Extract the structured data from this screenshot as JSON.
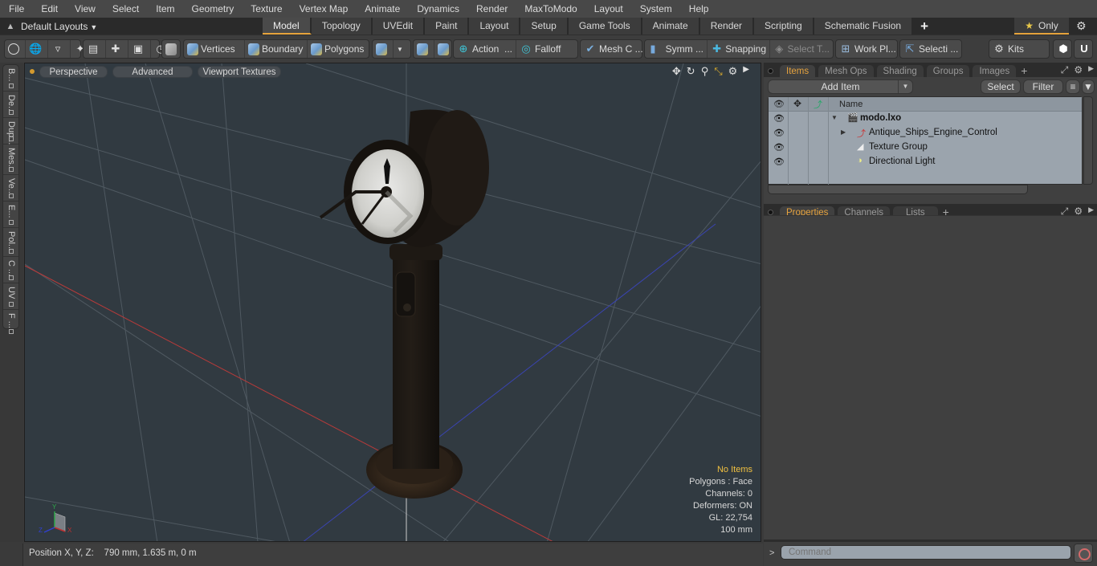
{
  "menubar": {
    "items": [
      "File",
      "Edit",
      "View",
      "Select",
      "Item",
      "Geometry",
      "Texture",
      "Vertex Map",
      "Animate",
      "Dynamics",
      "Render",
      "MaxToModo",
      "Layout",
      "System",
      "Help"
    ]
  },
  "layout_bar": {
    "layout_select": "Default Layouts",
    "tabs": [
      "Model",
      "Topology",
      "UVEdit",
      "Paint",
      "Layout",
      "Setup",
      "Game Tools",
      "Animate",
      "Render",
      "Scripting",
      "Schematic Fusion"
    ],
    "active_tab": "Model",
    "add_tab": "+",
    "only_label": "Only"
  },
  "toolbar": {
    "vertices": "Vertices",
    "boundary": "Boundary",
    "polygons": "Polygons",
    "action": "Action",
    "ellipsis": "...",
    "falloff": "Falloff",
    "mesh_c": "Mesh C ...",
    "symm": "Symm ...",
    "snapping": "Snapping",
    "select_t": "Select T...",
    "work_pl": "Work Pl...",
    "selecti": "Selecti ...",
    "kits": "Kits"
  },
  "left_tabs": [
    "B...",
    "De...",
    "Dup...",
    "Mes...",
    "Ve...",
    "E...",
    "Pol...",
    "C ...",
    "UV",
    "F ..."
  ],
  "viewport": {
    "view_mode": "Perspective",
    "shading": "Advanced",
    "textures": "Viewport Textures",
    "info": {
      "items": "No Items",
      "polygons": "Polygons : Face",
      "channels": "Channels: 0",
      "deformers": "Deformers: ON",
      "gl": "GL: 22,754",
      "scale": "100 mm"
    },
    "axis_labels": {
      "y": "Y",
      "x": "X",
      "z": "Z"
    }
  },
  "statusbar": {
    "position_label": "Position X, Y, Z:",
    "position_value": "790 mm, 1.635 m, 0 m"
  },
  "items_panel": {
    "tabs": [
      "Items",
      "Mesh Ops",
      "Shading",
      "Groups",
      "Images"
    ],
    "active_tab": "Items",
    "add_item": "Add Item",
    "select": "Select",
    "filter": "Filter",
    "column_name": "Name",
    "tree": [
      {
        "name": "modo.lxo",
        "type": "scene",
        "level": 0,
        "expanded": true
      },
      {
        "name": "Antique_Ships_Engine_Control",
        "type": "mesh",
        "level": 1,
        "expanded": false
      },
      {
        "name": "Texture Group",
        "type": "texture-group",
        "level": 1
      },
      {
        "name": "Directional Light",
        "type": "light",
        "level": 1
      }
    ]
  },
  "properties_panel": {
    "tabs": [
      "Properties",
      "Channels",
      "Lists"
    ],
    "active_tab": "Properties"
  },
  "command": {
    "prompt": ">",
    "placeholder": "Command"
  }
}
